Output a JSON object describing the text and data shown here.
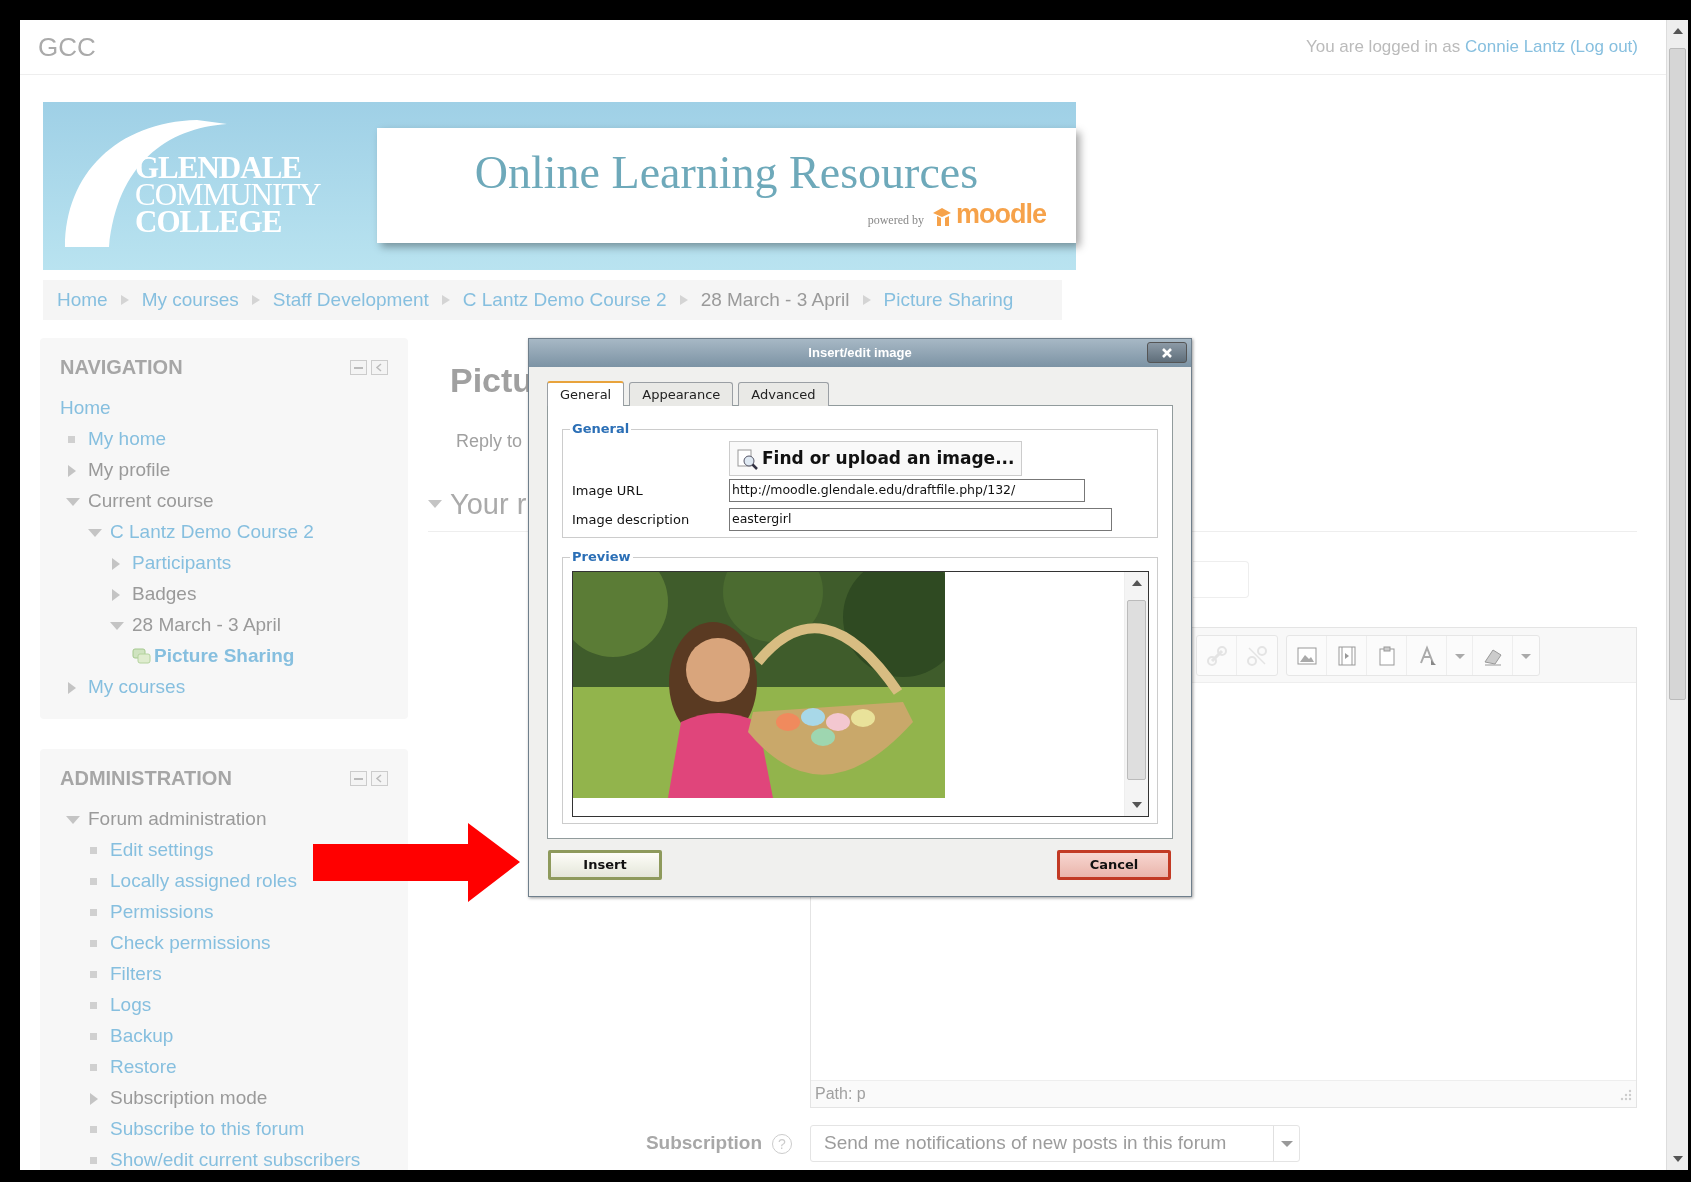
{
  "header": {
    "site": "GCC",
    "login_text": "You are logged in as",
    "user_link": "Connie Lantz",
    "logout_link": "(Log out)"
  },
  "banner": {
    "logo_lines": [
      "GLENDALE",
      "COMMUNITY",
      "COLLEGE"
    ],
    "title": "Online Learning Resources",
    "powered_by": "powered by",
    "brand": "moodle"
  },
  "breadcrumb": [
    {
      "label": "Home",
      "link": true
    },
    {
      "label": "My courses",
      "link": true
    },
    {
      "label": "Staff Development",
      "link": true
    },
    {
      "label": "C Lantz Demo Course 2",
      "link": true
    },
    {
      "label": "28 March - 3 April",
      "link": false
    },
    {
      "label": "Picture Sharing",
      "link": true
    }
  ],
  "navigation": {
    "title": "NAVIGATION",
    "items": [
      {
        "label": "Home",
        "kind": "plain",
        "link": true,
        "children": [
          {
            "label": "My home",
            "kind": "bullet",
            "link": true
          },
          {
            "label": "My profile",
            "kind": "closed",
            "link": false
          },
          {
            "label": "Current course",
            "kind": "open",
            "link": false,
            "children": [
              {
                "label": "C Lantz Demo Course 2",
                "kind": "open",
                "link": true,
                "children": [
                  {
                    "label": "Participants",
                    "kind": "closed",
                    "link": true
                  },
                  {
                    "label": "Badges",
                    "kind": "closed",
                    "link": false
                  },
                  {
                    "label": "28 March - 3 April",
                    "kind": "open",
                    "link": false,
                    "children": [
                      {
                        "label": "Picture Sharing",
                        "kind": "current",
                        "link": true
                      }
                    ]
                  }
                ]
              }
            ]
          },
          {
            "label": "My courses",
            "kind": "closed",
            "link": true
          }
        ]
      }
    ]
  },
  "administration": {
    "title": "ADMINISTRATION",
    "items": [
      {
        "label": "Forum administration",
        "kind": "open",
        "link": false,
        "children": [
          {
            "label": "Edit settings",
            "kind": "bullet",
            "link": true
          },
          {
            "label": "Locally assigned roles",
            "kind": "bullet",
            "link": true
          },
          {
            "label": "Permissions",
            "kind": "bullet",
            "link": true
          },
          {
            "label": "Check permissions",
            "kind": "bullet",
            "link": true
          },
          {
            "label": "Filters",
            "kind": "bullet",
            "link": true
          },
          {
            "label": "Logs",
            "kind": "bullet",
            "link": true
          },
          {
            "label": "Backup",
            "kind": "bullet",
            "link": true
          },
          {
            "label": "Restore",
            "kind": "bullet",
            "link": true
          },
          {
            "label": "Subscription mode",
            "kind": "closed",
            "link": false
          },
          {
            "label": "Subscribe to this forum",
            "kind": "bullet",
            "link": true
          },
          {
            "label": "Show/edit current subscribers",
            "kind": "bullet",
            "link": true
          }
        ]
      }
    ]
  },
  "main": {
    "heading": "Pictu",
    "reply": "Reply to",
    "section": {
      "title": "Your r",
      "expanded": true
    },
    "editor": {
      "path": "Path: p"
    },
    "subscription": {
      "label": "Subscription",
      "help": "?",
      "value": "Send me notifications of new posts in this forum"
    }
  },
  "dialog": {
    "title": "Insert/edit image",
    "tabs": [
      {
        "label": "General",
        "selected": true
      },
      {
        "label": "Appearance",
        "selected": false
      },
      {
        "label": "Advanced",
        "selected": false
      }
    ],
    "general_legend": "General",
    "find_button": "Find or upload an image...",
    "fields": [
      {
        "label": "Image URL",
        "value": "http://moodle.glendale.edu/draftfile.php/132/"
      },
      {
        "label": "Image description",
        "value": "eastergirl"
      }
    ],
    "preview_legend": "Preview",
    "buttons": [
      {
        "label": "Insert",
        "kind": "primary"
      },
      {
        "label": "Cancel",
        "kind": "cancel"
      }
    ]
  }
}
